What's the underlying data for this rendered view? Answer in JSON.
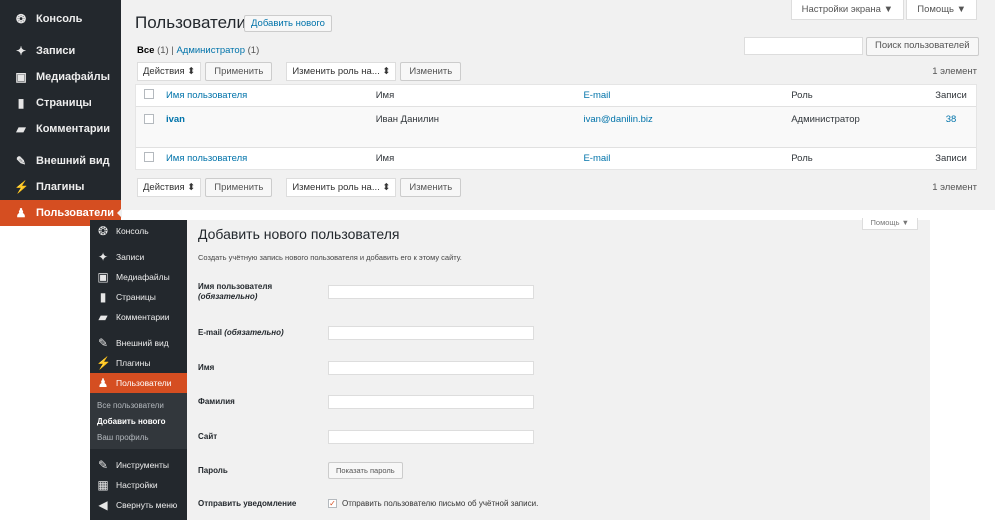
{
  "top": {
    "sidebar": [
      {
        "icon": "dashboard-icon",
        "glyph": "❂",
        "label": "Консоль"
      },
      {
        "icon": "pin-icon",
        "glyph": "✦",
        "label": "Записи"
      },
      {
        "icon": "media-icon",
        "glyph": "▣",
        "label": "Медиафайлы"
      },
      {
        "icon": "page-icon",
        "glyph": "▮",
        "label": "Страницы"
      },
      {
        "icon": "comment-icon",
        "glyph": "▰",
        "label": "Комментарии"
      },
      {
        "icon": "appearance-icon",
        "glyph": "✎",
        "label": "Внешний вид"
      },
      {
        "icon": "plugin-icon",
        "glyph": "⚡",
        "label": "Плагины"
      },
      {
        "icon": "users-icon",
        "glyph": "♟",
        "label": "Пользователи"
      }
    ],
    "title": "Пользователи",
    "add_new": "Добавить нового",
    "screen_options": "Настройки экрана ▼",
    "help": "Помощь ▼",
    "filter_all": "Все",
    "filter_all_count": "(1)",
    "filter_sep": "|",
    "filter_admin": "Администратор",
    "filter_admin_count": "(1)",
    "search_button": "Поиск пользователей",
    "bulk_actions": "Действия ⬍",
    "apply": "Применить",
    "change_role": "Изменить роль на... ⬍",
    "change": "Изменить",
    "items_count": "1 элемент",
    "columns": {
      "username": "Имя пользователя",
      "name": "Имя",
      "email": "E-mail",
      "role": "Роль",
      "posts": "Записи"
    },
    "row": {
      "username": "ivan",
      "name": "Иван Данилин",
      "email": "ivan@danilin.biz",
      "role": "Администратор",
      "posts": "38"
    }
  },
  "bottom": {
    "sidebar": [
      {
        "icon": "dashboard-icon",
        "glyph": "❂",
        "label": "Консоль"
      },
      {
        "icon": "pin-icon",
        "glyph": "✦",
        "label": "Записи"
      },
      {
        "icon": "media-icon",
        "glyph": "▣",
        "label": "Медиафайлы"
      },
      {
        "icon": "page-icon",
        "glyph": "▮",
        "label": "Страницы"
      },
      {
        "icon": "comment-icon",
        "glyph": "▰",
        "label": "Комментарии"
      },
      {
        "icon": "appearance-icon",
        "glyph": "✎",
        "label": "Внешний вид"
      },
      {
        "icon": "plugin-icon",
        "glyph": "⚡",
        "label": "Плагины"
      },
      {
        "icon": "users-icon",
        "glyph": "♟",
        "label": "Пользователи"
      }
    ],
    "submenu": [
      "Все пользователи",
      "Добавить нового",
      "Ваш профиль"
    ],
    "sidebar_tail": [
      {
        "icon": "tools-icon",
        "glyph": "✎",
        "label": "Инструменты"
      },
      {
        "icon": "settings-icon",
        "glyph": "▦",
        "label": "Настройки"
      },
      {
        "icon": "collapse-icon",
        "glyph": "◀",
        "label": "Свернуть меню"
      }
    ],
    "help": "Помощь ▼",
    "title": "Добавить нового пользователя",
    "description": "Создать учётную запись нового пользователя и добавить его к этому сайту.",
    "fields": {
      "username": "Имя пользователя",
      "required": "(обязательно)",
      "email": "E-mail",
      "first_name": "Имя",
      "last_name": "Фамилия",
      "website": "Сайт",
      "password": "Пароль",
      "show_password": "Показать пароль",
      "notify": "Отправить уведомление",
      "notify_text": "Отправить пользователю письмо об учётной записи.",
      "check_mark": "✓"
    }
  },
  "colors": {
    "accent": "#d54e21",
    "link": "#0073aa",
    "sidebar": "#23282d"
  }
}
